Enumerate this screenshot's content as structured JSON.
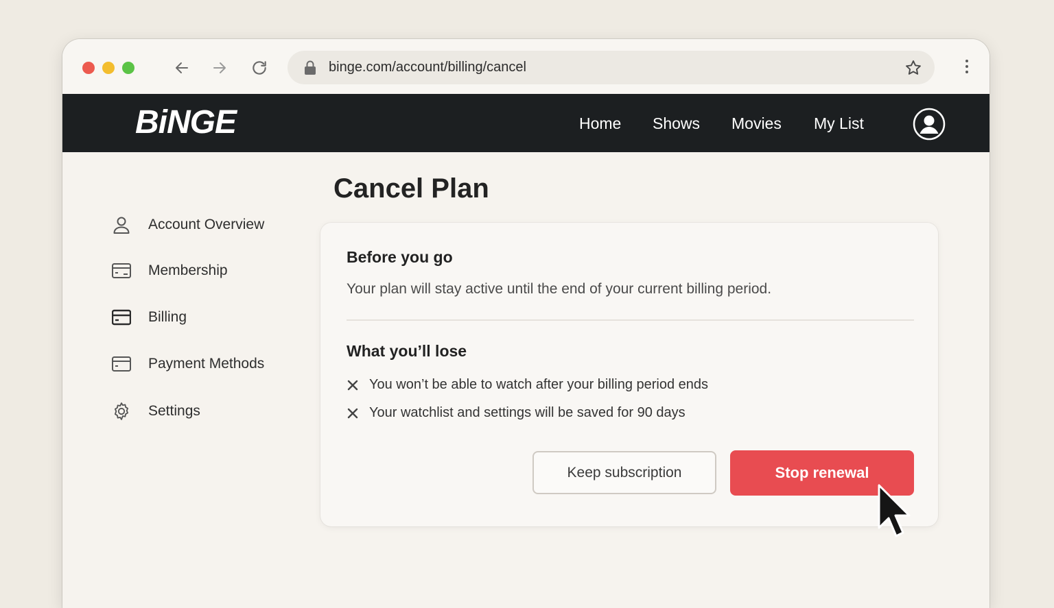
{
  "browser": {
    "url": "binge.com/account/billing/cancel"
  },
  "header": {
    "logo": "BiNGE",
    "nav": [
      "Home",
      "Shows",
      "Movies",
      "My List"
    ]
  },
  "sidebar": {
    "items": [
      {
        "label": "Account Overview",
        "icon": "user-icon"
      },
      {
        "label": "Membership",
        "icon": "card-icon"
      },
      {
        "label": "Billing",
        "icon": "card-icon"
      },
      {
        "label": "Payment Methods",
        "icon": "card-icon"
      },
      {
        "label": "Settings",
        "icon": "gear-icon"
      }
    ]
  },
  "main": {
    "title": "Cancel Plan",
    "before_heading": "Before you go",
    "before_text": "Your plan will stay active until the end of your current billing period.",
    "lose_heading": "What you’ll lose",
    "lose_items": [
      "You won’t be able to watch after your billing period ends",
      "Your watchlist and settings will be saved for 90 days"
    ],
    "keep_label": "Keep subscription",
    "stop_label": "Stop renewal"
  },
  "colors": {
    "accent": "#e84c51",
    "header_bg": "#1c1f21"
  }
}
